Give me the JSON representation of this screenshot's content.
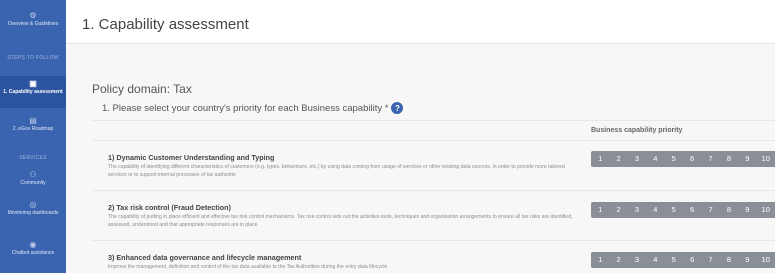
{
  "sidebar": {
    "items": [
      {
        "icon": "gear-icon",
        "glyph": "⚙",
        "label": "Overview & Guidelines",
        "active": false
      },
      {
        "icon": "",
        "glyph": "",
        "label": "STEPS TO FOLLOW",
        "section": true
      },
      {
        "icon": "document-icon",
        "glyph": "▣",
        "label": "1. Capability assessment",
        "active": true
      },
      {
        "icon": "roadmap-icon",
        "glyph": "▤",
        "label": "2. eGov Roadmap",
        "active": false
      },
      {
        "icon": "",
        "glyph": "",
        "label": "SERVICES",
        "section": true
      },
      {
        "icon": "community-icon",
        "glyph": "⚇",
        "label": "Community",
        "active": false
      },
      {
        "icon": "monitor-icon",
        "glyph": "◎",
        "label": "Monitoring dashboards",
        "active": false
      },
      {
        "icon": "chatbot-icon",
        "glyph": "◉",
        "label": "Chatbot assistance",
        "active": false
      }
    ]
  },
  "header": {
    "title": "1. Capability assessment"
  },
  "main": {
    "domain_title": "Policy domain: Tax",
    "question": "1. Please select your country's priority for each Business capability *",
    "help_glyph": "?",
    "priority_header": "Business capability priority",
    "scale": [
      "1",
      "2",
      "3",
      "4",
      "5",
      "6",
      "7",
      "8",
      "9",
      "10"
    ],
    "capabilities": [
      {
        "title": "1) Dynamic Customer Understanding and Typing",
        "desc": "The capability of identifying different characteristics of customers (e.g. types, behaviours, etc.) by using data coming from usage of services or other existing data sources, in order to provide more tailored services or to support internal processes of tax authoritie"
      },
      {
        "title": "2) Tax risk control (Fraud Detection)",
        "desc": "The capability of putting in place efficient and effective tax risk control mechanisms. Tax risk control sets out the activities tools, techniques and organisation arrangements to ensure all tax risks are identified, assessed, understood and that appropriate responses are in place"
      },
      {
        "title": "3) Enhanced data governance and lifecycle management",
        "desc": "Improve the management, definition and control of the tax data available to the Tax Authorities during the entry data lifecycle"
      }
    ]
  }
}
